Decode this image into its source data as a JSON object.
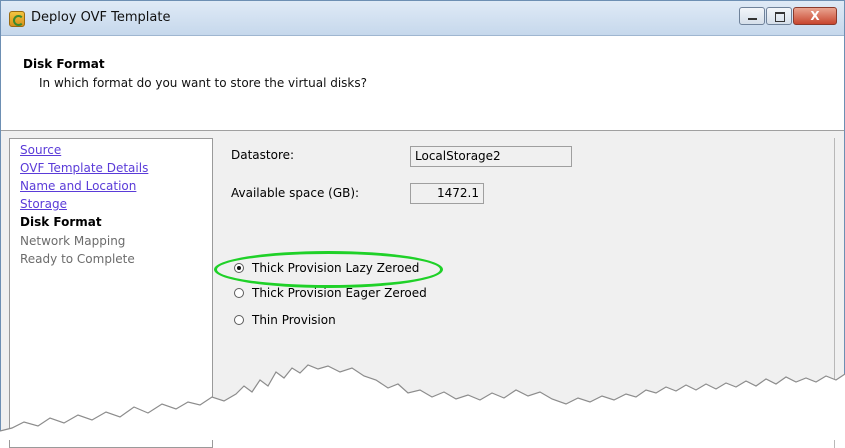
{
  "window": {
    "title": "Deploy OVF Template",
    "icon": "vsphere-app-icon",
    "controls": [
      "minimize-icon",
      "maximize-icon",
      "close-icon"
    ],
    "close_label": "X"
  },
  "header": {
    "title": "Disk Format",
    "subtitle": "In which format do you want to store the virtual disks?"
  },
  "steps": [
    {
      "label": "Source",
      "state": "link"
    },
    {
      "label": "OVF Template Details",
      "state": "link"
    },
    {
      "label": "Name and Location",
      "state": "link"
    },
    {
      "label": "Storage",
      "state": "link"
    },
    {
      "label": "Disk Format",
      "state": "current"
    },
    {
      "label": "Network Mapping",
      "state": "disabled"
    },
    {
      "label": "Ready to Complete",
      "state": "disabled"
    }
  ],
  "form": {
    "datastore_label": "Datastore:",
    "datastore_value": "LocalStorage2",
    "space_label": "Available space (GB):",
    "space_value": "1472.1",
    "options": [
      {
        "label": "Thick Provision Lazy Zeroed",
        "checked": true
      },
      {
        "label": "Thick Provision Eager Zeroed",
        "checked": false
      },
      {
        "label": "Thin Provision",
        "checked": false
      }
    ]
  },
  "colors": {
    "highlight": "#1fd128",
    "link": "#5a3bd8",
    "panel_bg": "#f0f0f0"
  }
}
